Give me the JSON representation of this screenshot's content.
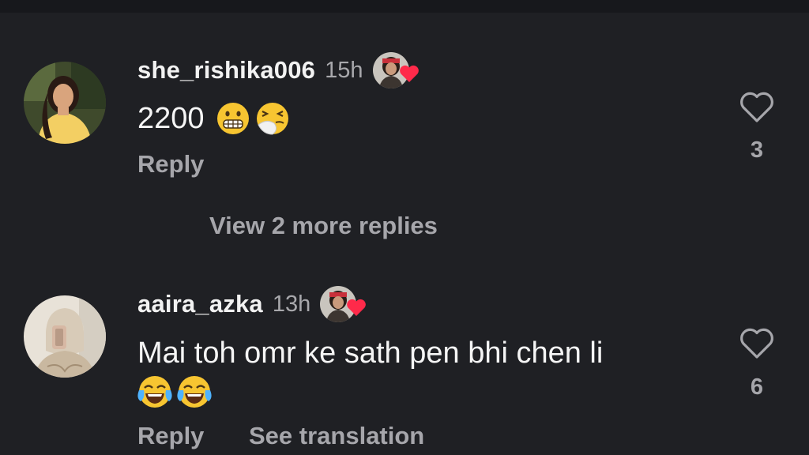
{
  "comments": [
    {
      "username": "she_rishika006",
      "time": "15h",
      "text": "2200",
      "emojis": [
        "grimacing-face-emoji",
        "sneezing-face-emoji"
      ],
      "reply_label": "Reply",
      "likes": "3"
    },
    {
      "username": "aaira_azka",
      "time": "13h",
      "text": "Mai toh omr ke sath pen bhi chen li",
      "emojis": [
        "face-with-tears-of-joy-emoji",
        "face-with-tears-of-joy-emoji"
      ],
      "reply_label": "Reply",
      "translate_label": "See translation",
      "likes": "6"
    }
  ],
  "view_more_replies": "View 2 more replies",
  "colors": {
    "background": "#1f2024",
    "primary_text": "#f3f3f3",
    "secondary_text": "#a6a6ab",
    "heart_red": "#ff2a4a",
    "emoji_yellow": "#f7c531"
  }
}
